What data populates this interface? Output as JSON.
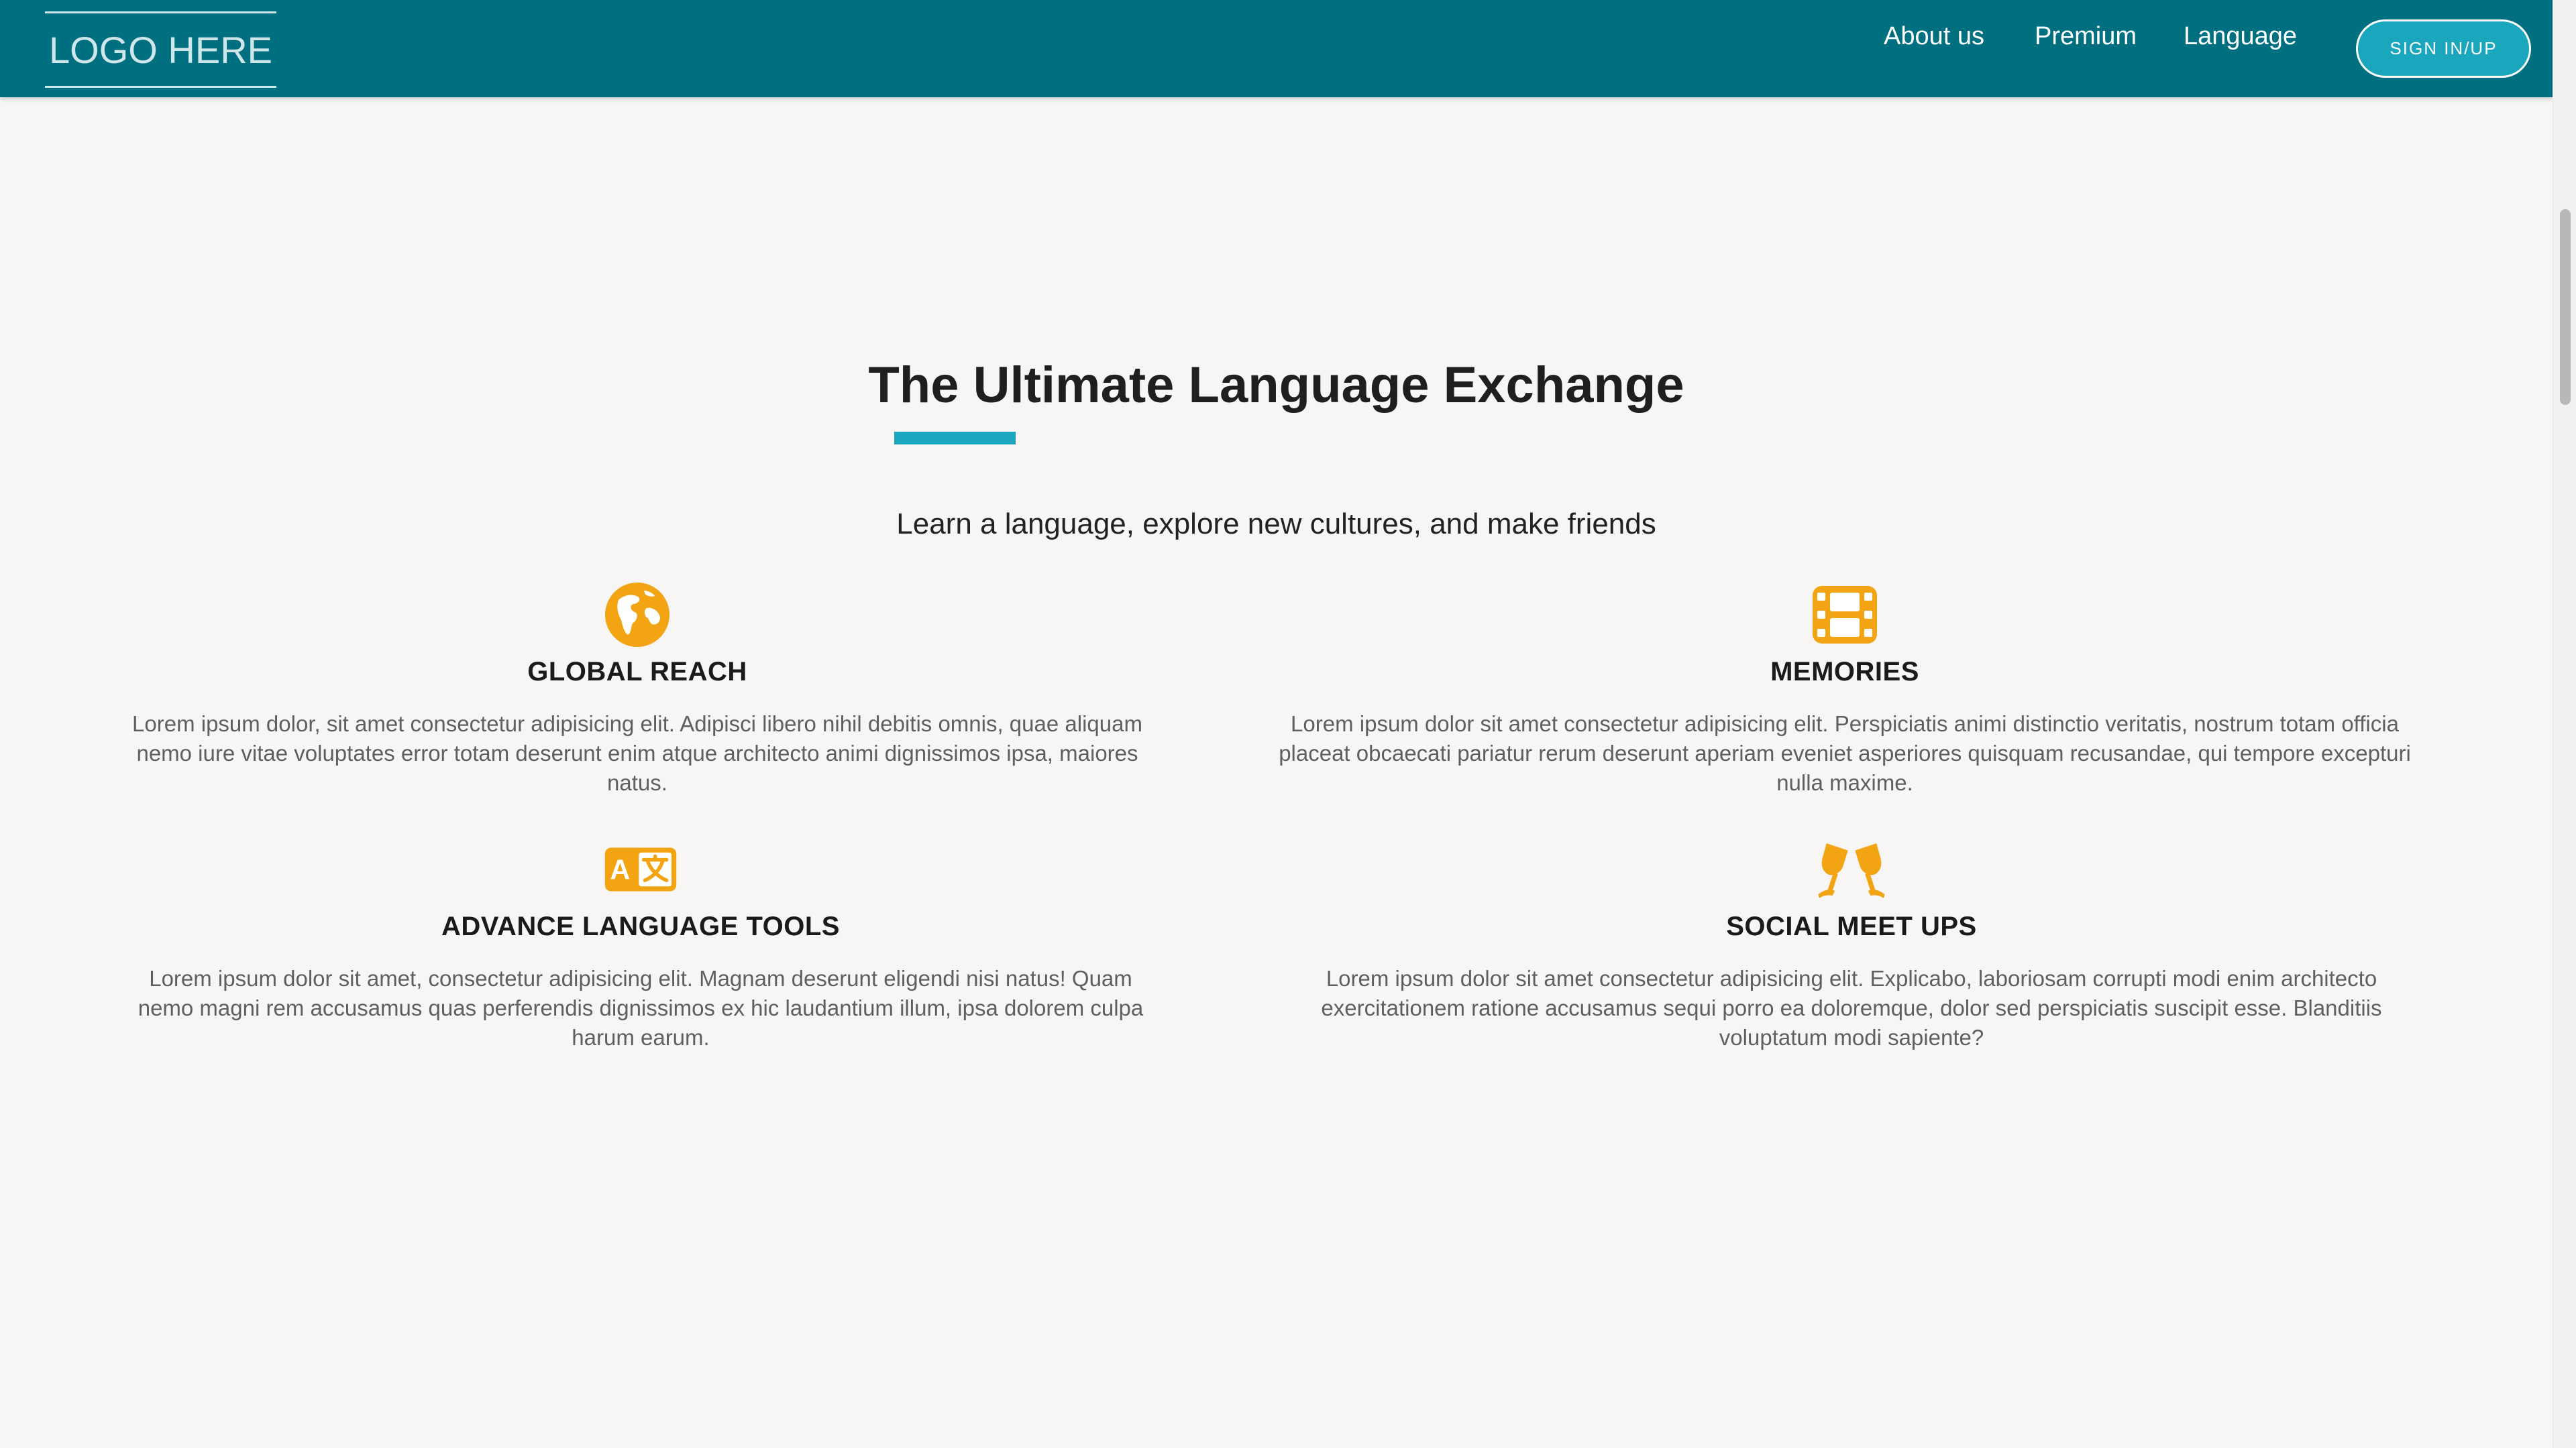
{
  "navbar": {
    "logo_text": "LOGO HERE",
    "links": [
      "About us",
      "Premium",
      "Language"
    ],
    "signin_label": "SIGN IN/UP"
  },
  "hero": {
    "title": "The Ultimate Language Exchange",
    "subtitle": "Learn a language, explore new cultures, and make friends"
  },
  "features": [
    {
      "icon": "globe-icon",
      "title": "GLOBAL REACH",
      "description": "Lorem ipsum dolor, sit amet consectetur adipisicing elit. Adipisci libero nihil debitis omnis, quae aliquam nemo iure vitae voluptates error totam deserunt enim atque architecto animi dignissimos ipsa, maiores natus."
    },
    {
      "icon": "film-icon",
      "title": "MEMORIES",
      "description": "Lorem ipsum dolor sit amet consectetur adipisicing elit. Perspiciatis animi distinctio veritatis, nostrum totam officia placeat obcaecati pariatur rerum deserunt aperiam eveniet asperiores quisquam recusandae, qui tempore excepturi nulla maxime."
    },
    {
      "icon": "translate-icon",
      "title": "ADVANCE LANGUAGE TOOLS",
      "description": "Lorem ipsum dolor sit amet, consectetur adipisicing elit. Magnam deserunt eligendi nisi natus! Quam nemo magni rem accusamus quas perferendis dignissimos ex hic laudantium illum, ipsa dolorem culpa harum earum."
    },
    {
      "icon": "glasses-cheers-icon",
      "title": "SOCIAL MEET UPS",
      "description": "Lorem ipsum dolor sit amet consectetur adipisicing elit. Explicabo, laboriosam corrupti modi enim architecto exercitationem ratione accusamus sequi porro ea doloremque, dolor sed perspiciatis suscipit esse. Blanditiis voluptatum modi sapiente?"
    }
  ],
  "colors": {
    "navbar": "#007080",
    "accent": "#1aa6bd",
    "icon": "#f2a413",
    "background": "#f7f6f4"
  }
}
